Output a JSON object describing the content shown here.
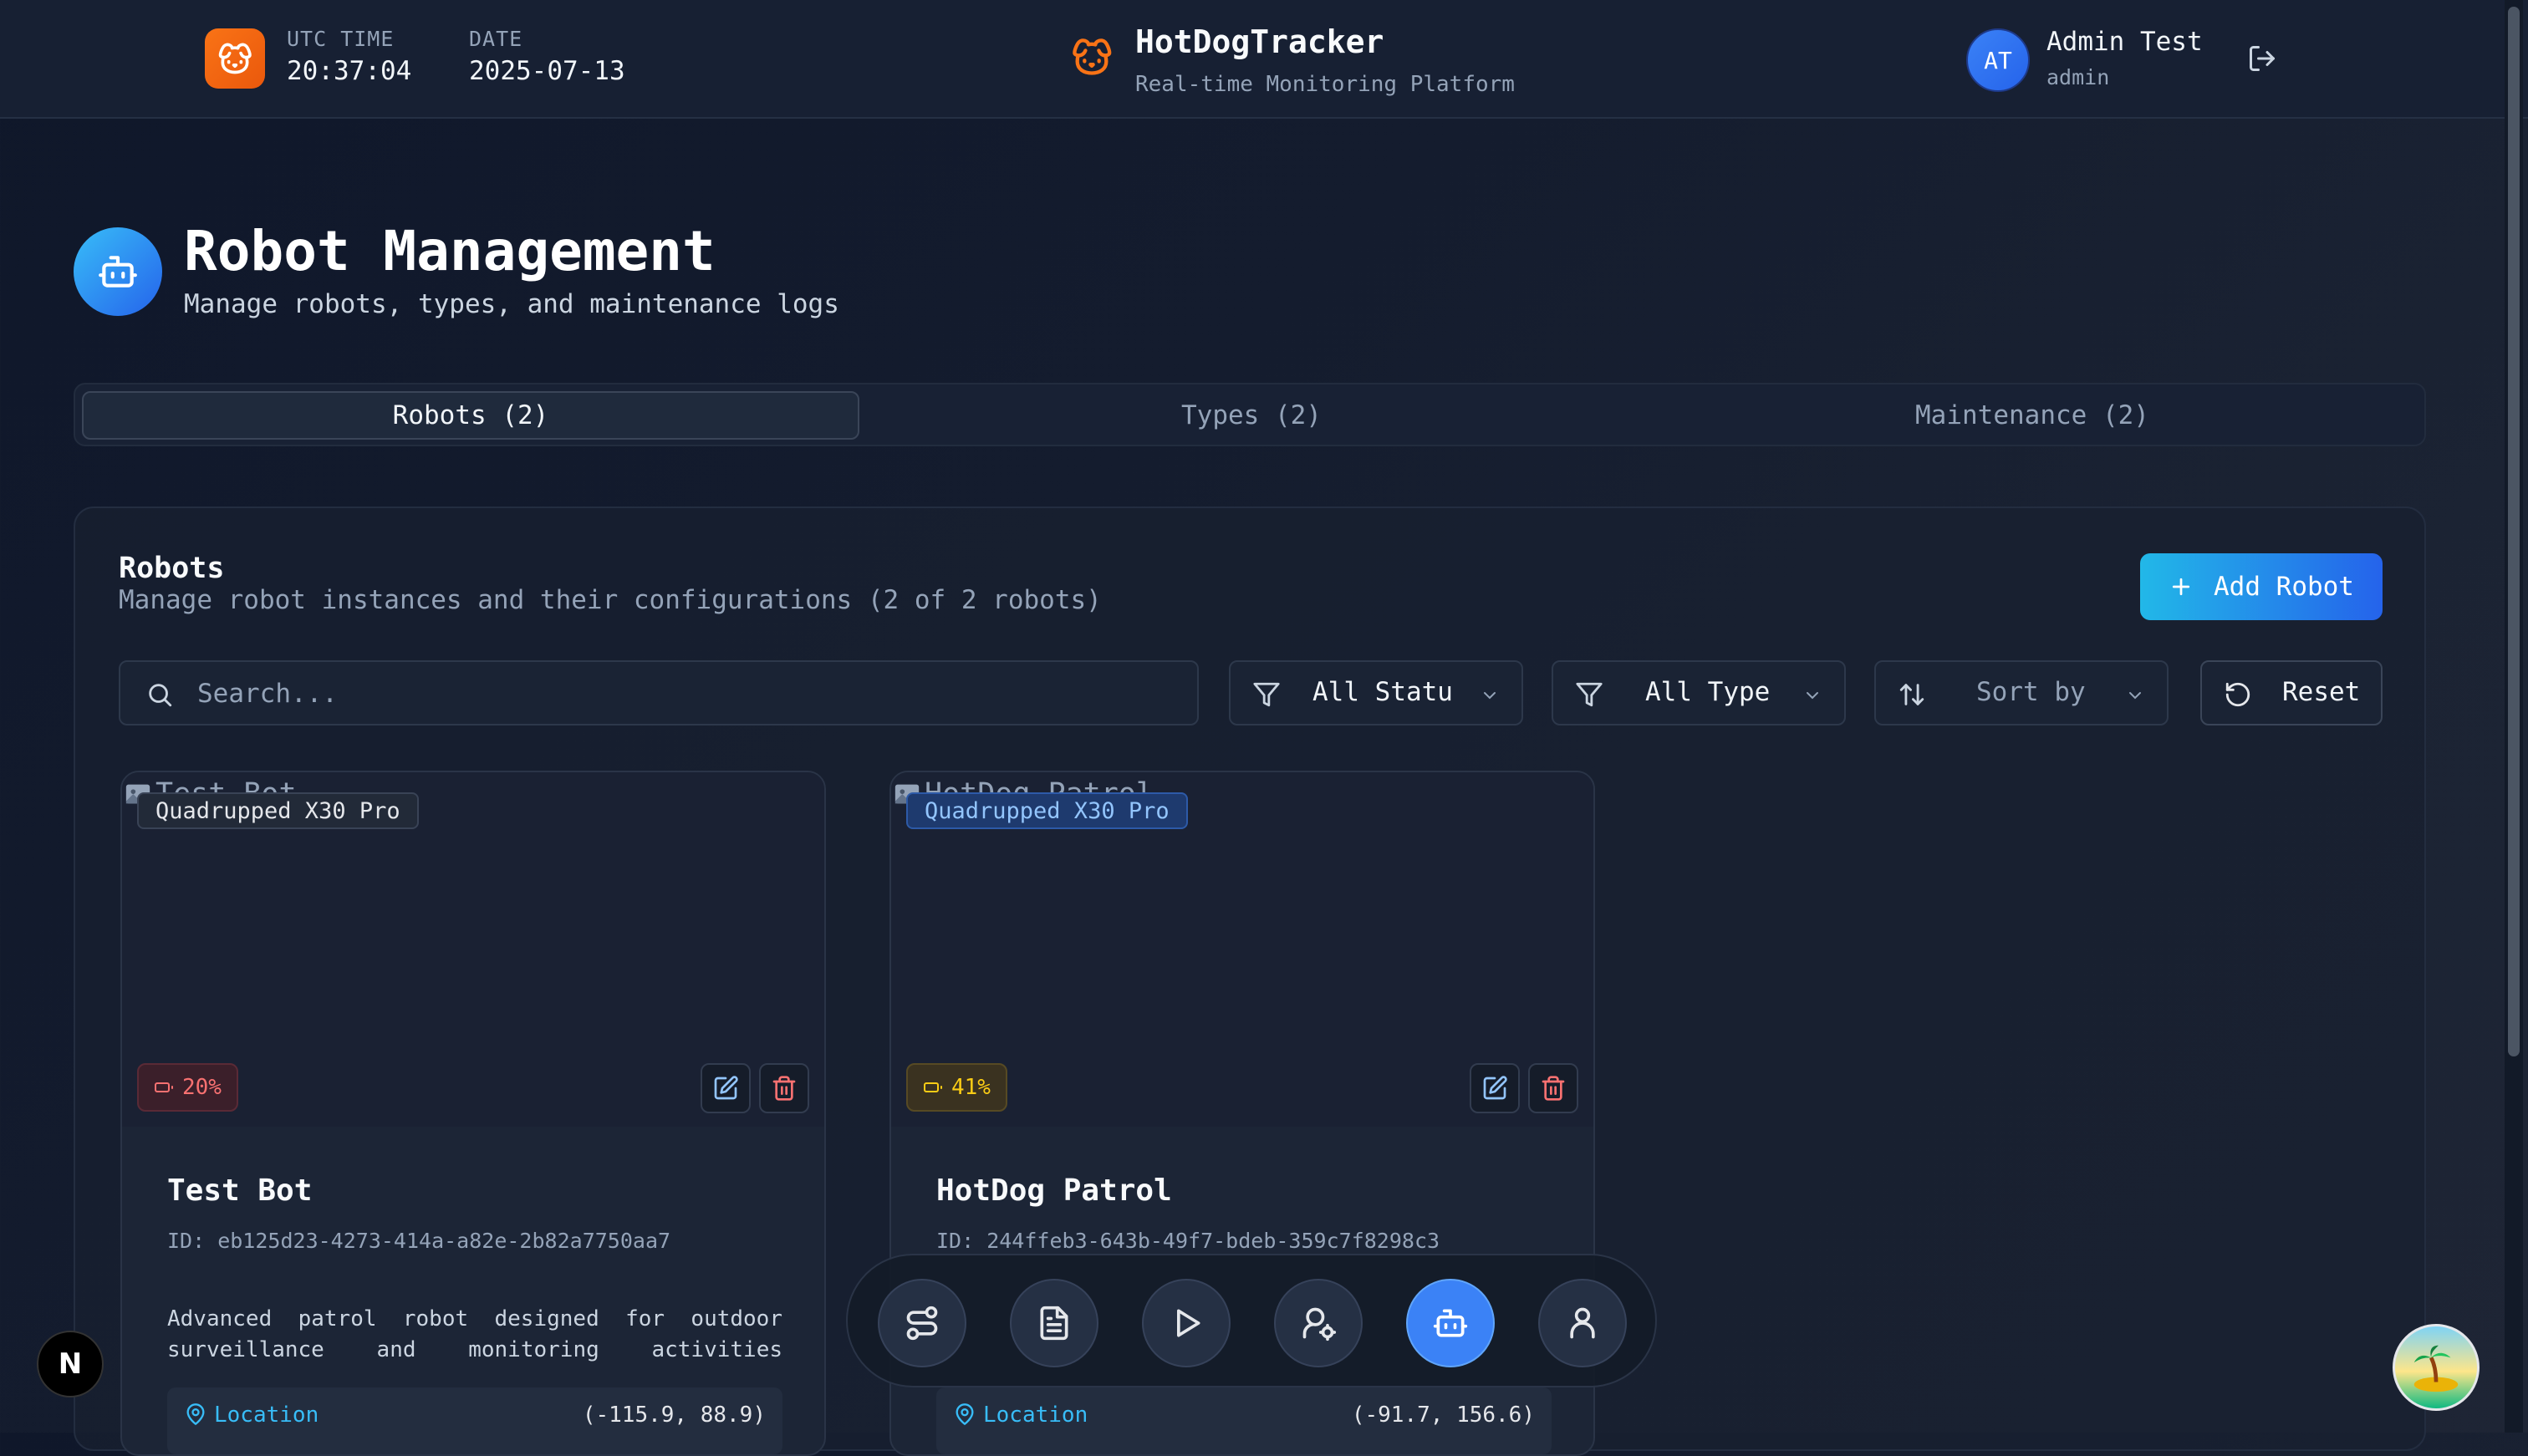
{
  "header": {
    "utc_label": "UTC TIME",
    "utc_value": "20:37:04",
    "date_label": "DATE",
    "date_value": "2025-07-13",
    "brand_title": "HotDogTracker",
    "brand_subtitle": "Real-time Monitoring Platform",
    "avatar_initials": "AT",
    "user_name": "Admin Test",
    "user_role": "admin"
  },
  "page": {
    "title": "Robot Management",
    "subtitle": "Manage robots, types, and maintenance logs"
  },
  "tabs": [
    {
      "label": "Robots (2)",
      "active": true
    },
    {
      "label": "Types (2)",
      "active": false
    },
    {
      "label": "Maintenance (2)",
      "active": false
    }
  ],
  "panel": {
    "title": "Robots",
    "subtitle": "Manage robot instances and their configurations (2 of 2 robots)",
    "add_label": "Add Robot",
    "search_placeholder": "Search...",
    "status_filter": "All Status",
    "type_filter": "All Type",
    "sort_label": "Sort by",
    "reset_label": "Reset"
  },
  "robots": [
    {
      "name": "Test Bot",
      "image_alt": "Test Bot",
      "type": "Quadrupped X30 Pro",
      "battery": "20%",
      "id_text": "ID: eb125d23-4273-414a-a82e-2b82a7750aa7",
      "description": "Advanced patrol robot designed for outdoor surveillance and monitoring activities",
      "location_label": "Location",
      "location_value": "(-115.9, 88.9)"
    },
    {
      "name": "HotDog Patrol",
      "image_alt": "HotDog Patrol",
      "type": "Quadrupped X30 Pro",
      "battery": "41%",
      "id_text": "ID: 244ffeb3-643b-49f7-bdeb-359c7f8298c3",
      "description": "",
      "location_label": "Location",
      "location_value": "(-91.7, 156.6)"
    }
  ],
  "dock": [
    {
      "icon": "route-icon",
      "active": false
    },
    {
      "icon": "document-icon",
      "active": false
    },
    {
      "icon": "play-icon",
      "active": false
    },
    {
      "icon": "user-settings-icon",
      "active": false
    },
    {
      "icon": "robot-icon",
      "active": true
    },
    {
      "icon": "user-icon",
      "active": false
    }
  ],
  "badges": {
    "framework_letter": "N"
  },
  "colors": {
    "accent_blue": "#3b82f6",
    "brand_orange": "#f97316",
    "battery_low": "#f87171",
    "battery_mid": "#facc15",
    "location_cyan": "#38bdf8"
  }
}
